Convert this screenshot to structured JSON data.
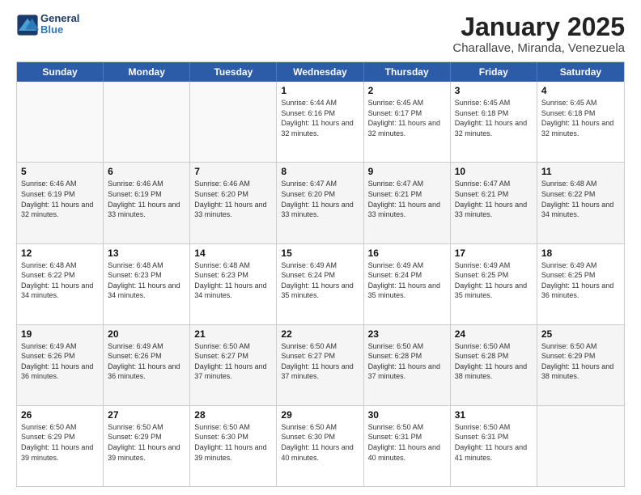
{
  "logo": {
    "text_general": "General",
    "text_blue": "Blue"
  },
  "title": "January 2025",
  "location": "Charallave, Miranda, Venezuela",
  "header_days": [
    "Sunday",
    "Monday",
    "Tuesday",
    "Wednesday",
    "Thursday",
    "Friday",
    "Saturday"
  ],
  "weeks": [
    [
      {
        "day": "",
        "info": ""
      },
      {
        "day": "",
        "info": ""
      },
      {
        "day": "",
        "info": ""
      },
      {
        "day": "1",
        "info": "Sunrise: 6:44 AM\nSunset: 6:16 PM\nDaylight: 11 hours and 32 minutes."
      },
      {
        "day": "2",
        "info": "Sunrise: 6:45 AM\nSunset: 6:17 PM\nDaylight: 11 hours and 32 minutes."
      },
      {
        "day": "3",
        "info": "Sunrise: 6:45 AM\nSunset: 6:18 PM\nDaylight: 11 hours and 32 minutes."
      },
      {
        "day": "4",
        "info": "Sunrise: 6:45 AM\nSunset: 6:18 PM\nDaylight: 11 hours and 32 minutes."
      }
    ],
    [
      {
        "day": "5",
        "info": "Sunrise: 6:46 AM\nSunset: 6:19 PM\nDaylight: 11 hours and 32 minutes."
      },
      {
        "day": "6",
        "info": "Sunrise: 6:46 AM\nSunset: 6:19 PM\nDaylight: 11 hours and 33 minutes."
      },
      {
        "day": "7",
        "info": "Sunrise: 6:46 AM\nSunset: 6:20 PM\nDaylight: 11 hours and 33 minutes."
      },
      {
        "day": "8",
        "info": "Sunrise: 6:47 AM\nSunset: 6:20 PM\nDaylight: 11 hours and 33 minutes."
      },
      {
        "day": "9",
        "info": "Sunrise: 6:47 AM\nSunset: 6:21 PM\nDaylight: 11 hours and 33 minutes."
      },
      {
        "day": "10",
        "info": "Sunrise: 6:47 AM\nSunset: 6:21 PM\nDaylight: 11 hours and 33 minutes."
      },
      {
        "day": "11",
        "info": "Sunrise: 6:48 AM\nSunset: 6:22 PM\nDaylight: 11 hours and 34 minutes."
      }
    ],
    [
      {
        "day": "12",
        "info": "Sunrise: 6:48 AM\nSunset: 6:22 PM\nDaylight: 11 hours and 34 minutes."
      },
      {
        "day": "13",
        "info": "Sunrise: 6:48 AM\nSunset: 6:23 PM\nDaylight: 11 hours and 34 minutes."
      },
      {
        "day": "14",
        "info": "Sunrise: 6:48 AM\nSunset: 6:23 PM\nDaylight: 11 hours and 34 minutes."
      },
      {
        "day": "15",
        "info": "Sunrise: 6:49 AM\nSunset: 6:24 PM\nDaylight: 11 hours and 35 minutes."
      },
      {
        "day": "16",
        "info": "Sunrise: 6:49 AM\nSunset: 6:24 PM\nDaylight: 11 hours and 35 minutes."
      },
      {
        "day": "17",
        "info": "Sunrise: 6:49 AM\nSunset: 6:25 PM\nDaylight: 11 hours and 35 minutes."
      },
      {
        "day": "18",
        "info": "Sunrise: 6:49 AM\nSunset: 6:25 PM\nDaylight: 11 hours and 36 minutes."
      }
    ],
    [
      {
        "day": "19",
        "info": "Sunrise: 6:49 AM\nSunset: 6:26 PM\nDaylight: 11 hours and 36 minutes."
      },
      {
        "day": "20",
        "info": "Sunrise: 6:49 AM\nSunset: 6:26 PM\nDaylight: 11 hours and 36 minutes."
      },
      {
        "day": "21",
        "info": "Sunrise: 6:50 AM\nSunset: 6:27 PM\nDaylight: 11 hours and 37 minutes."
      },
      {
        "day": "22",
        "info": "Sunrise: 6:50 AM\nSunset: 6:27 PM\nDaylight: 11 hours and 37 minutes."
      },
      {
        "day": "23",
        "info": "Sunrise: 6:50 AM\nSunset: 6:28 PM\nDaylight: 11 hours and 37 minutes."
      },
      {
        "day": "24",
        "info": "Sunrise: 6:50 AM\nSunset: 6:28 PM\nDaylight: 11 hours and 38 minutes."
      },
      {
        "day": "25",
        "info": "Sunrise: 6:50 AM\nSunset: 6:29 PM\nDaylight: 11 hours and 38 minutes."
      }
    ],
    [
      {
        "day": "26",
        "info": "Sunrise: 6:50 AM\nSunset: 6:29 PM\nDaylight: 11 hours and 39 minutes."
      },
      {
        "day": "27",
        "info": "Sunrise: 6:50 AM\nSunset: 6:29 PM\nDaylight: 11 hours and 39 minutes."
      },
      {
        "day": "28",
        "info": "Sunrise: 6:50 AM\nSunset: 6:30 PM\nDaylight: 11 hours and 39 minutes."
      },
      {
        "day": "29",
        "info": "Sunrise: 6:50 AM\nSunset: 6:30 PM\nDaylight: 11 hours and 40 minutes."
      },
      {
        "day": "30",
        "info": "Sunrise: 6:50 AM\nSunset: 6:31 PM\nDaylight: 11 hours and 40 minutes."
      },
      {
        "day": "31",
        "info": "Sunrise: 6:50 AM\nSunset: 6:31 PM\nDaylight: 11 hours and 41 minutes."
      },
      {
        "day": "",
        "info": ""
      }
    ]
  ]
}
